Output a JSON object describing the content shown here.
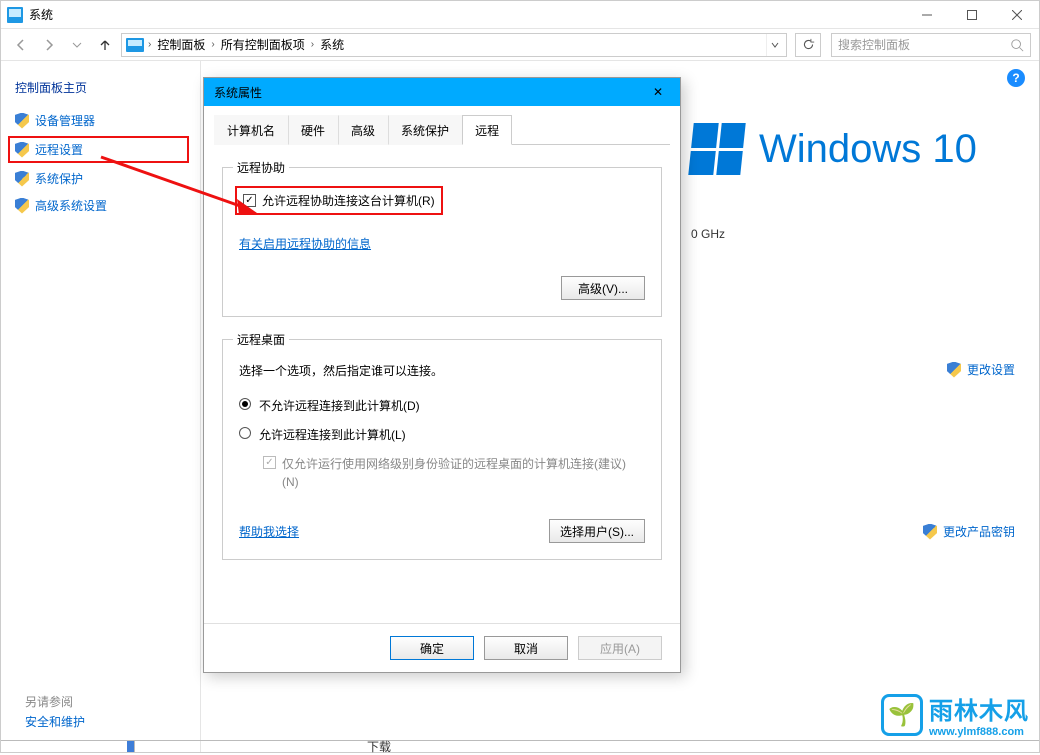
{
  "window_title": "系统",
  "breadcrumb": {
    "sep": "›",
    "items": [
      "控制面板",
      "所有控制面板项",
      "系统"
    ]
  },
  "search_placeholder": "搜索控制面板",
  "help_tooltip": "?",
  "sidebar": {
    "title": "控制面板主页",
    "items": [
      "设备管理器",
      "远程设置",
      "系统保护",
      "高级系统设置"
    ]
  },
  "main": {
    "windows_logo_text": "Windows 10",
    "processor_tail": "0 GHz",
    "change_settings_label": "更改设置",
    "change_product_key_label": "更改产品密钥",
    "see_also_heading": "另请参阅",
    "see_also_link": "安全和维护",
    "download_stub": "下载"
  },
  "dialog": {
    "title": "系统属性",
    "close_char": "✕",
    "tabs": [
      "计算机名",
      "硬件",
      "高级",
      "系统保护",
      "远程"
    ],
    "active_tab_index": 4,
    "remote_assist_group": "远程协助",
    "allow_remote_assist_label": "允许远程协助连接这台计算机(R)",
    "remote_assist_info_link": "有关启用远程协助的信息",
    "advanced_button": "高级(V)...",
    "remote_desktop_group": "远程桌面",
    "remote_desktop_intro": "选择一个选项，然后指定谁可以连接。",
    "radio_disallow": "不允许远程连接到此计算机(D)",
    "radio_allow": "允许远程连接到此计算机(L)",
    "nla_label_line1": "仅允许运行使用网络级别身份验证的远程桌面的计算机连接(建议)",
    "nla_label_line2": "(N)",
    "help_choose_link": "帮助我选择",
    "select_users_button": "选择用户(S)...",
    "ok_button": "确定",
    "cancel_button": "取消",
    "apply_button": "应用(A)"
  },
  "watermark": {
    "cn": "雨林木风",
    "url": "www.ylmf888.com"
  }
}
